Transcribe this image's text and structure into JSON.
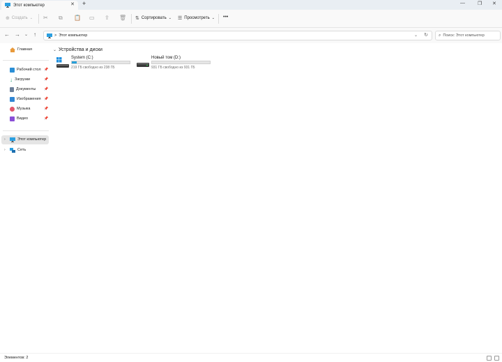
{
  "window": {
    "tab_title": "Этот компьютер",
    "new_tab_icon": "plus-icon",
    "controls": [
      "minimize-icon",
      "maximize-icon",
      "close-icon"
    ]
  },
  "toolbar": {
    "create_label": "Создать",
    "sort_label": "Сортировать",
    "view_label": "Просмотреть",
    "more_label": "•••"
  },
  "address": {
    "path": "Этот компьютер",
    "separator": ">",
    "search_placeholder": "Поиск: Этот компьютер"
  },
  "sidebar": {
    "home": "Главная",
    "quick_access": [
      {
        "label": "Рабочий стол",
        "icon": "desktop-icon",
        "color": "#2b8fd6"
      },
      {
        "label": "Загрузки",
        "icon": "downloads-icon",
        "color": "#2aa17a"
      },
      {
        "label": "Документы",
        "icon": "documents-icon",
        "color": "#6b7f99"
      },
      {
        "label": "Изображения",
        "icon": "pictures-icon",
        "color": "#2f86d4"
      },
      {
        "label": "Музыка",
        "icon": "music-icon",
        "color": "#e2566a"
      },
      {
        "label": "Видео",
        "icon": "video-icon",
        "color": "#8a4fd6"
      }
    ],
    "this_pc": "Этот компьютер",
    "network": "Сеть"
  },
  "main": {
    "group_title": "Устройства и диски",
    "drives": [
      {
        "name": "System (C:)",
        "free_text": "219 ГБ свободно из 238 ГБ",
        "used_fraction": 0.08,
        "icon": "windows-drive-icon"
      },
      {
        "name": "Новый том (D:)",
        "free_text": "931 ГБ свободно из 931 ГБ",
        "used_fraction": 0.0,
        "icon": "drive-icon"
      }
    ]
  },
  "status": {
    "items_count": "Элементов: 2"
  },
  "colors": {
    "accent": "#26a0da",
    "selected_bg": "#e5e5e5"
  }
}
